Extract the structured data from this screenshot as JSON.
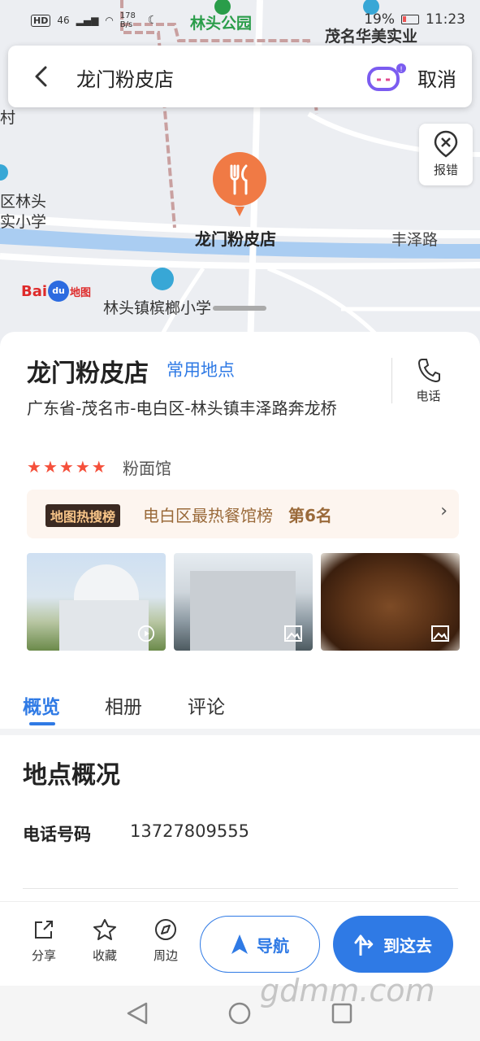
{
  "status_bar": {
    "network": "46",
    "speed": "178 B/s",
    "battery": "19%",
    "time": "11:23"
  },
  "map": {
    "labels": {
      "park": "林头公园",
      "company": "茂名华美实业",
      "left_edge_1": "村",
      "left_edge_2": "区林头",
      "left_edge_3": "实小学",
      "place": "龙门粉皮店",
      "road": "丰泽路",
      "school": "林头镇槟榔小学"
    },
    "logo": {
      "bai": "Bai",
      "du": "du",
      "ditu": "地图"
    }
  },
  "search": {
    "query": "龙门粉皮店",
    "cancel_label": "取消"
  },
  "report_label": "报错",
  "place": {
    "name": "龙门粉皮店",
    "tag": "常用地点",
    "phone_button_label": "电话",
    "address": "广东省-茂名市-电白区-林头镇丰泽路奔龙桥",
    "rating_stars": 5,
    "category": "粉面馆"
  },
  "hot_list": {
    "badge": "地图热搜榜",
    "text": "电白区最热餐馆榜",
    "rank": "第6名"
  },
  "photos": [
    {
      "icon": "play-icon"
    },
    {
      "icon": "image-icon"
    },
    {
      "icon": "image-icon"
    }
  ],
  "tabs": [
    {
      "label": "概览",
      "active": true
    },
    {
      "label": "相册",
      "active": false
    },
    {
      "label": "评论",
      "active": false
    }
  ],
  "overview": {
    "title": "地点概况",
    "phone_label": "电话号码",
    "phone_value": "13727809555"
  },
  "bottom_bar": {
    "share": "分享",
    "favorite": "收藏",
    "nearby": "周边",
    "navigate": "导航",
    "go_here": "到这去"
  },
  "watermark": "gdmm.com",
  "colors": {
    "accent": "#2f7ae5",
    "pin": "#f07a45",
    "star": "#f5503b",
    "hot_text": "#9a6a3a"
  }
}
